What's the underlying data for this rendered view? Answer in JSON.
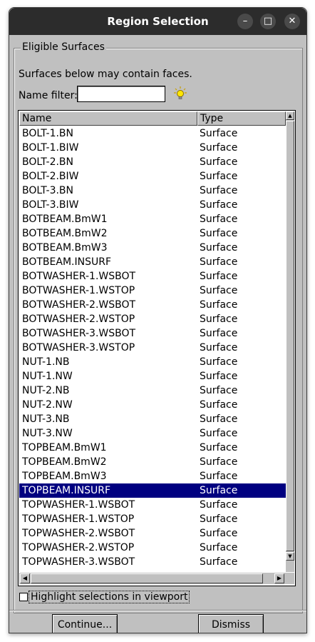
{
  "window": {
    "title": "Region Selection",
    "controls": {
      "minimize": "–",
      "maximize": "□",
      "close": "✕"
    }
  },
  "group": {
    "legend": "Eligible Surfaces",
    "description": "Surfaces below may contain faces.",
    "filter_label": "Name filter:",
    "filter_value": "",
    "filter_icon": "lightbulb-icon"
  },
  "table": {
    "columns": [
      "Name",
      "Type"
    ],
    "rows": [
      {
        "name": "BOLT-1.BN",
        "type": "Surface"
      },
      {
        "name": "BOLT-1.BIW",
        "type": "Surface"
      },
      {
        "name": "BOLT-2.BN",
        "type": "Surface"
      },
      {
        "name": "BOLT-2.BIW",
        "type": "Surface"
      },
      {
        "name": "BOLT-3.BN",
        "type": "Surface"
      },
      {
        "name": "BOLT-3.BIW",
        "type": "Surface"
      },
      {
        "name": "BOTBEAM.BmW1",
        "type": "Surface"
      },
      {
        "name": "BOTBEAM.BmW2",
        "type": "Surface"
      },
      {
        "name": "BOTBEAM.BmW3",
        "type": "Surface"
      },
      {
        "name": "BOTBEAM.INSURF",
        "type": "Surface"
      },
      {
        "name": "BOTWASHER-1.WSBOT",
        "type": "Surface"
      },
      {
        "name": "BOTWASHER-1.WSTOP",
        "type": "Surface"
      },
      {
        "name": "BOTWASHER-2.WSBOT",
        "type": "Surface"
      },
      {
        "name": "BOTWASHER-2.WSTOP",
        "type": "Surface"
      },
      {
        "name": "BOTWASHER-3.WSBOT",
        "type": "Surface"
      },
      {
        "name": "BOTWASHER-3.WSTOP",
        "type": "Surface"
      },
      {
        "name": "NUT-1.NB",
        "type": "Surface"
      },
      {
        "name": "NUT-1.NW",
        "type": "Surface"
      },
      {
        "name": "NUT-2.NB",
        "type": "Surface"
      },
      {
        "name": "NUT-2.NW",
        "type": "Surface"
      },
      {
        "name": "NUT-3.NB",
        "type": "Surface"
      },
      {
        "name": "NUT-3.NW",
        "type": "Surface"
      },
      {
        "name": "TOPBEAM.BmW1",
        "type": "Surface"
      },
      {
        "name": "TOPBEAM.BmW2",
        "type": "Surface"
      },
      {
        "name": "TOPBEAM.BmW3",
        "type": "Surface"
      },
      {
        "name": "TOPBEAM.INSURF",
        "type": "Surface",
        "selected": true
      },
      {
        "name": "TOPWASHER-1.WSBOT",
        "type": "Surface"
      },
      {
        "name": "TOPWASHER-1.WSTOP",
        "type": "Surface"
      },
      {
        "name": "TOPWASHER-2.WSBOT",
        "type": "Surface"
      },
      {
        "name": "TOPWASHER-2.WSTOP",
        "type": "Surface"
      },
      {
        "name": "TOPWASHER-3.WSBOT",
        "type": "Surface"
      }
    ],
    "selection_color": "#000080"
  },
  "options": {
    "highlight_label": "Highlight selections in viewport",
    "highlight_checked": false
  },
  "buttons": {
    "continue": "Continue...",
    "dismiss": "Dismiss"
  }
}
